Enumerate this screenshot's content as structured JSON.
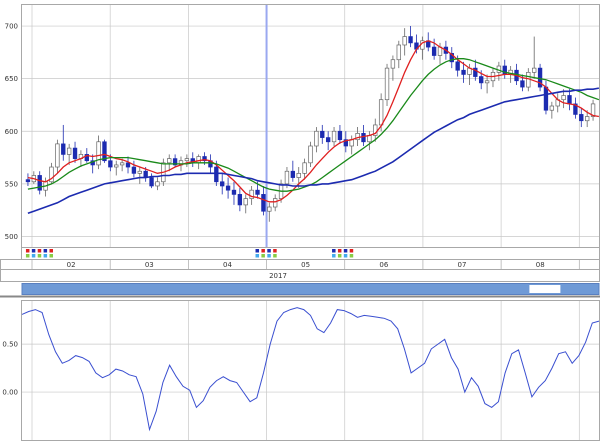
{
  "colors": {
    "candle_up_fill": "#ffffff",
    "candle_up_stroke": "#666666",
    "candle_down": "#1c2bb0",
    "ma_short": "#e02020",
    "ma_mid": "#1a8a1a",
    "ma_long": "#1c2bb0",
    "oscillator": "#3a4fd0",
    "cursor_line": "#9aa8f0",
    "scrollbar": "#6f9ad6",
    "grid": "#c8c8c8"
  },
  "scrollbar": {
    "value": 0.93
  },
  "cursor": {
    "month": "05"
  },
  "chart_data": [
    {
      "type": "candlestick",
      "title": "",
      "x_year_label": "2017",
      "x_month_labels": [
        "02",
        "03",
        "04",
        "05",
        "06",
        "07",
        "08"
      ],
      "y_ticks": [
        500,
        550,
        600,
        650,
        700
      ],
      "ylim": [
        490,
        720
      ],
      "grid": true,
      "candles": [
        [
          554,
          560,
          548,
          552
        ],
        [
          552,
          562,
          550,
          558
        ],
        [
          558,
          562,
          540,
          544
        ],
        [
          544,
          556,
          538,
          552
        ],
        [
          552,
          570,
          550,
          566
        ],
        [
          566,
          592,
          560,
          588
        ],
        [
          588,
          606,
          572,
          578
        ],
        [
          578,
          588,
          568,
          584
        ],
        [
          584,
          590,
          570,
          574
        ],
        [
          574,
          582,
          566,
          578
        ],
        [
          578,
          584,
          570,
          572
        ],
        [
          572,
          578,
          560,
          568
        ],
        [
          568,
          596,
          564,
          590
        ],
        [
          590,
          592,
          570,
          572
        ],
        [
          572,
          578,
          562,
          566
        ],
        [
          566,
          572,
          558,
          568
        ],
        [
          568,
          574,
          562,
          570
        ],
        [
          570,
          576,
          560,
          566
        ],
        [
          566,
          572,
          556,
          560
        ],
        [
          560,
          566,
          550,
          562
        ],
        [
          562,
          566,
          552,
          556
        ],
        [
          556,
          560,
          546,
          548
        ],
        [
          548,
          556,
          544,
          552
        ],
        [
          552,
          574,
          548,
          570
        ],
        [
          570,
          578,
          562,
          574
        ],
        [
          574,
          578,
          566,
          568
        ],
        [
          568,
          576,
          562,
          572
        ],
        [
          572,
          578,
          566,
          574
        ],
        [
          574,
          580,
          566,
          570
        ],
        [
          570,
          578,
          564,
          576
        ],
        [
          576,
          580,
          568,
          572
        ],
        [
          572,
          578,
          560,
          566
        ],
        [
          566,
          572,
          548,
          552
        ],
        [
          552,
          560,
          540,
          548
        ],
        [
          548,
          556,
          536,
          544
        ],
        [
          544,
          552,
          530,
          540
        ],
        [
          540,
          546,
          524,
          530
        ],
        [
          530,
          540,
          522,
          536
        ],
        [
          536,
          548,
          530,
          544
        ],
        [
          544,
          552,
          536,
          540
        ],
        [
          540,
          548,
          520,
          524
        ],
        [
          524,
          532,
          514,
          528
        ],
        [
          528,
          540,
          524,
          536
        ],
        [
          536,
          554,
          532,
          550
        ],
        [
          550,
          566,
          546,
          562
        ],
        [
          562,
          572,
          552,
          556
        ],
        [
          556,
          566,
          546,
          560
        ],
        [
          560,
          574,
          554,
          570
        ],
        [
          570,
          590,
          566,
          586
        ],
        [
          586,
          604,
          580,
          600
        ],
        [
          600,
          606,
          588,
          594
        ],
        [
          594,
          600,
          582,
          590
        ],
        [
          590,
          604,
          586,
          600
        ],
        [
          600,
          606,
          588,
          592
        ],
        [
          592,
          600,
          580,
          586
        ],
        [
          586,
          596,
          578,
          592
        ],
        [
          592,
          604,
          586,
          598
        ],
        [
          598,
          606,
          586,
          590
        ],
        [
          590,
          600,
          582,
          596
        ],
        [
          596,
          612,
          590,
          606
        ],
        [
          606,
          636,
          600,
          630
        ],
        [
          630,
          664,
          624,
          660
        ],
        [
          660,
          672,
          648,
          668
        ],
        [
          668,
          686,
          660,
          682
        ],
        [
          682,
          698,
          672,
          690
        ],
        [
          690,
          700,
          680,
          684
        ],
        [
          684,
          692,
          674,
          678
        ],
        [
          678,
          690,
          668,
          686
        ],
        [
          686,
          694,
          676,
          680
        ],
        [
          680,
          688,
          668,
          672
        ],
        [
          672,
          684,
          664,
          680
        ],
        [
          680,
          686,
          668,
          674
        ],
        [
          674,
          680,
          660,
          666
        ],
        [
          666,
          672,
          652,
          658
        ],
        [
          658,
          666,
          646,
          654
        ],
        [
          654,
          664,
          644,
          660
        ],
        [
          660,
          668,
          648,
          652
        ],
        [
          652,
          658,
          640,
          646
        ],
        [
          646,
          654,
          636,
          648
        ],
        [
          648,
          660,
          642,
          656
        ],
        [
          656,
          666,
          648,
          662
        ],
        [
          662,
          668,
          650,
          654
        ],
        [
          654,
          662,
          646,
          658
        ],
        [
          658,
          664,
          644,
          648
        ],
        [
          648,
          654,
          638,
          642
        ],
        [
          642,
          660,
          638,
          656
        ],
        [
          656,
          690,
          650,
          660
        ],
        [
          660,
          664,
          638,
          642
        ],
        [
          642,
          648,
          616,
          620
        ],
        [
          620,
          628,
          612,
          624
        ],
        [
          624,
          636,
          618,
          630
        ],
        [
          630,
          640,
          622,
          634
        ],
        [
          634,
          640,
          620,
          626
        ],
        [
          626,
          632,
          612,
          616
        ],
        [
          616,
          622,
          604,
          610
        ],
        [
          610,
          620,
          604,
          614
        ],
        [
          614,
          630,
          610,
          626
        ]
      ],
      "series": [
        {
          "values": [
            556,
            555,
            553,
            552,
            555,
            560,
            566,
            570,
            572,
            574,
            577,
            576,
            577,
            578,
            576,
            574,
            573,
            571,
            568,
            566,
            564,
            562,
            560,
            561,
            563,
            566,
            568,
            570,
            571,
            572,
            573,
            572,
            568,
            563,
            558,
            553,
            547,
            541,
            538,
            537,
            535,
            533,
            533,
            535,
            539,
            544,
            550,
            555,
            561,
            568,
            574,
            580,
            585,
            589,
            591,
            592,
            594,
            595,
            596,
            598,
            605,
            615,
            628,
            642,
            656,
            668,
            678,
            684,
            686,
            684,
            680,
            677,
            673,
            668,
            664,
            660,
            658,
            655,
            652,
            652,
            653,
            654,
            654,
            653,
            651,
            650,
            648,
            646,
            642,
            636,
            630,
            627,
            626,
            625,
            622,
            618,
            615,
            614
          ]
        },
        {
          "values": [
            545,
            546,
            547,
            548,
            550,
            553,
            557,
            561,
            564,
            567,
            569,
            571,
            573,
            574,
            575,
            575,
            575,
            575,
            574,
            573,
            572,
            571,
            570,
            569,
            569,
            569,
            569,
            569,
            570,
            570,
            570,
            570,
            569,
            567,
            565,
            562,
            559,
            556,
            553,
            550,
            547,
            545,
            544,
            543,
            543,
            544,
            545,
            547,
            549,
            552,
            556,
            560,
            564,
            568,
            572,
            576,
            580,
            584,
            588,
            592,
            597,
            603,
            610,
            618,
            626,
            634,
            641,
            648,
            654,
            659,
            663,
            666,
            668,
            669,
            669,
            668,
            666,
            664,
            662,
            660,
            658,
            656,
            655,
            654,
            653,
            652,
            651,
            650,
            649,
            647,
            645,
            643,
            641,
            639,
            637,
            634,
            632,
            630
          ]
        },
        {
          "values": [
            522,
            524,
            526,
            528,
            530,
            532,
            535,
            538,
            540,
            542,
            544,
            546,
            548,
            550,
            551,
            552,
            553,
            554,
            555,
            556,
            556,
            557,
            557,
            558,
            558,
            559,
            559,
            560,
            560,
            560,
            560,
            560,
            560,
            560,
            559,
            558,
            557,
            556,
            555,
            553,
            552,
            551,
            550,
            549,
            549,
            548,
            548,
            548,
            549,
            549,
            550,
            550,
            551,
            552,
            553,
            554,
            556,
            558,
            560,
            562,
            565,
            568,
            571,
            575,
            579,
            583,
            587,
            591,
            595,
            599,
            602,
            605,
            608,
            611,
            613,
            616,
            618,
            620,
            622,
            624,
            626,
            628,
            629,
            630,
            631,
            632,
            633,
            634,
            635,
            636,
            637,
            638,
            638,
            639,
            639,
            640,
            640,
            641
          ]
        }
      ]
    },
    {
      "type": "line",
      "title": "",
      "y_ticks": [
        "0.50",
        "0.00"
      ],
      "ylim": [
        -0.5,
        0.95
      ],
      "series": [
        {
          "values": [
            0.81,
            0.84,
            0.86,
            0.83,
            0.6,
            0.42,
            0.3,
            0.33,
            0.38,
            0.36,
            0.32,
            0.2,
            0.15,
            0.18,
            0.24,
            0.22,
            0.18,
            0.16,
            -0.02,
            -0.39,
            -0.2,
            0.1,
            0.28,
            0.16,
            0.06,
            0.02,
            -0.16,
            -0.09,
            0.05,
            0.12,
            0.16,
            0.12,
            0.1,
            0.0,
            -0.1,
            -0.06,
            0.2,
            0.5,
            0.74,
            0.83,
            0.86,
            0.88,
            0.86,
            0.8,
            0.66,
            0.62,
            0.72,
            0.86,
            0.85,
            0.82,
            0.78,
            0.8,
            0.79,
            0.78,
            0.77,
            0.74,
            0.66,
            0.45,
            0.2,
            0.25,
            0.3,
            0.45,
            0.5,
            0.55,
            0.36,
            0.24,
            0.0,
            0.15,
            0.06,
            -0.12,
            -0.16,
            -0.1,
            0.2,
            0.4,
            0.44,
            0.2,
            -0.05,
            0.05,
            0.12,
            0.25,
            0.4,
            0.42,
            0.3,
            0.38,
            0.52,
            0.72,
            0.74
          ]
        }
      ]
    }
  ]
}
